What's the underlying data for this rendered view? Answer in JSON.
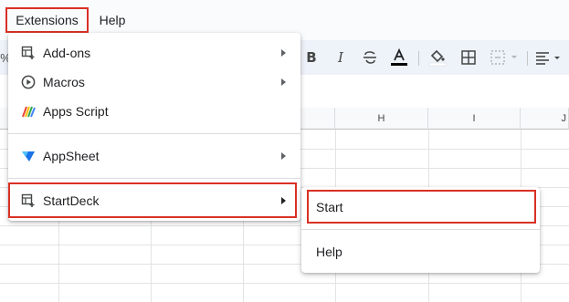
{
  "menubar": {
    "extensions": "Extensions",
    "help": "Help"
  },
  "toolbar": {
    "bold": "B",
    "italic": "I",
    "percent": "%"
  },
  "grid": {
    "columns": [
      "H",
      "I",
      "J"
    ]
  },
  "extensions_menu": {
    "items": [
      {
        "label": "Add-ons",
        "icon": "addon-icon",
        "submenu": true
      },
      {
        "label": "Macros",
        "icon": "macros-play-icon",
        "submenu": true
      },
      {
        "label": "Apps Script",
        "icon": "apps-script-icon",
        "submenu": false
      },
      {
        "label": "AppSheet",
        "icon": "appsheet-icon",
        "submenu": true
      },
      {
        "label": "StartDeck",
        "icon": "startdeck-addon-icon",
        "submenu": true
      }
    ]
  },
  "startdeck_submenu": {
    "items": [
      {
        "label": "Start"
      },
      {
        "label": "Help"
      }
    ]
  },
  "colors": {
    "highlight": "#d93025",
    "accent": "#1a73e8"
  }
}
